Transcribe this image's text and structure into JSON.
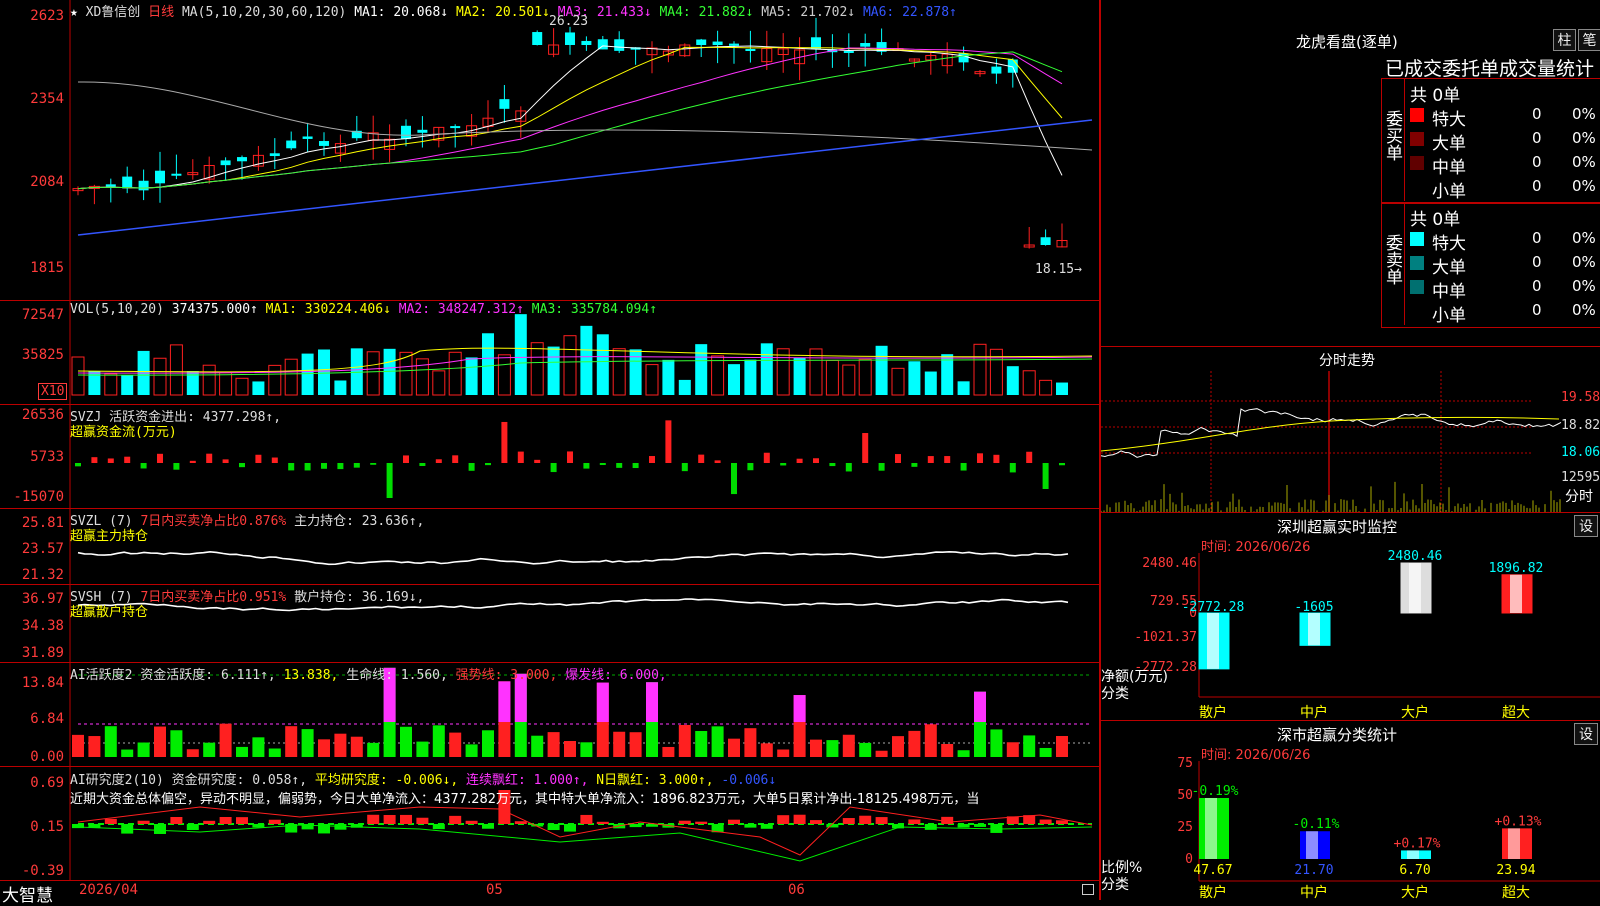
{
  "main": {
    "star": "★",
    "stock_title": "XD鲁信创",
    "period": "日线",
    "ma_label": "MA(5,10,20,30,60,120)",
    "ma1": "MA1: 20.068↓",
    "ma2": "MA2: 20.501↓",
    "ma3": "MA3: 21.433↓",
    "ma4": "MA4: 21.882↓",
    "ma5": "MA5: 21.702↓",
    "ma6": "MA6: 22.878↑",
    "high_mark": "26.23",
    "low_mark": "18.15→",
    "y_ticks": [
      "2623",
      "2354",
      "2084",
      "1815"
    ]
  },
  "vol": {
    "legend": "VOL(5,10,20)",
    "value": "374375.000↑",
    "ma1": "MA1: 330224.406↓",
    "ma2": "MA2: 348247.312↑",
    "ma3": "MA3: 335784.094↑",
    "y_ticks": [
      "72547",
      "35825"
    ],
    "unit": "X10"
  },
  "svzj": {
    "legend": "SVZJ  活跃资金进出: 4377.298↑,",
    "sub": "超赢资金流(万元)",
    "y_ticks": [
      "26536",
      "5733",
      "-15070"
    ]
  },
  "svzl": {
    "legend_a": "SVZL (7)",
    "legend_b": "7日内买卖净占比0.876%",
    "legend_c": "主力持仓: 23.636↑,",
    "sub": "超赢主力持仓",
    "y_ticks": [
      "25.81",
      "23.57",
      "21.32"
    ]
  },
  "svsh": {
    "legend_a": "SVSH (7)",
    "legend_b": "7日内买卖净占比0.951%",
    "legend_c": "散户持仓: 36.169↓,",
    "sub": "超赢散户持仓",
    "y_ticks": [
      "36.97",
      "34.38",
      "31.89"
    ]
  },
  "ai1": {
    "legend_a": "AI活跃度2 资金活跃度: 6.111↑,",
    "legend_b": "13.838,",
    "legend_c": "生命线: 1.560,",
    "legend_d": "强势线: 3.000,",
    "legend_e": "爆发线: 6.000,",
    "y_ticks": [
      "13.84",
      "6.84",
      "0.00"
    ]
  },
  "ai2": {
    "legend_a": "AI研究度2(10)",
    "legend_b": "资金研究度: 0.058↑,",
    "legend_c": "平均研究度: -0.006↓,",
    "legend_d": "连续飘红: 1.000↑,",
    "legend_e": "N日飘红: 3.000↑,",
    "legend_f": "-0.006↓",
    "summary": "近期大资金总体偏空，异动不明显，偏弱势，今日大单净流入：4377.282万元，其中特大单净流入：1896.823万元，大单5日累计净出-18125.498万元，当",
    "y_ticks": [
      "0.69",
      "0.15",
      "-0.39"
    ]
  },
  "bottom": {
    "brand": "大智慧",
    "date_start": "2026/04",
    "month_05": "05",
    "month_06": "06"
  },
  "right": {
    "lhb_title": "龙虎看盘(逐单)",
    "btn_zhu": "柱",
    "btn_bi": "笔",
    "stats_title": "已成交委托单成交量统计",
    "buy": {
      "count": "共 0单",
      "side_label": "委买单",
      "rows": [
        {
          "name": "特大",
          "val": "0",
          "pct": "0%"
        },
        {
          "name": "大单",
          "val": "0",
          "pct": "0%"
        },
        {
          "name": "中单",
          "val": "0",
          "pct": "0%"
        },
        {
          "name": "小单",
          "val": "0",
          "pct": "0%"
        }
      ]
    },
    "sell": {
      "count": "共 0单",
      "side_label": "委卖单",
      "rows": [
        {
          "name": "特大",
          "val": "0",
          "pct": "0%"
        },
        {
          "name": "大单",
          "val": "0",
          "pct": "0%"
        },
        {
          "name": "中单",
          "val": "0",
          "pct": "0%"
        },
        {
          "name": "小单",
          "val": "0",
          "pct": "0%"
        }
      ]
    },
    "intraday_title": "分时走势",
    "intraday_ticks": [
      "19.58",
      "18.82",
      "18.06",
      "12595"
    ],
    "intraday_unit": "分时",
    "monitor_title": "深圳超赢实时监控",
    "monitor_btn": "设",
    "monitor_time": "时间: 2026/06/26",
    "monitor_y": [
      "2480.46",
      "729.55",
      "0",
      "-1021.37",
      "-2772.28"
    ],
    "monitor_ylabel": "净额(万元)",
    "monitor_xlabel": "分类",
    "monitor_values": [
      "-2772.28",
      "-1605",
      "2480.46",
      "1896.82"
    ],
    "class_title": "深市超赢分类统计",
    "class_btn": "设",
    "class_time": "时间: 2026/06/26",
    "class_y": [
      "75",
      "50",
      "25",
      "0"
    ],
    "class_ylabel": "比例%",
    "class_xlabel": "分类",
    "class_top": [
      "-0.19%",
      "-0.11%",
      "+0.17%",
      "+0.13%"
    ],
    "class_vals": [
      "47.67",
      "21.70",
      "6.70",
      "23.94"
    ],
    "cats": [
      "散户",
      "中户",
      "大户",
      "超大"
    ]
  },
  "colors": {
    "up": "#ff2020",
    "down": "#00ffff",
    "border": "#b00000",
    "axis": "#ff3b3b"
  }
}
